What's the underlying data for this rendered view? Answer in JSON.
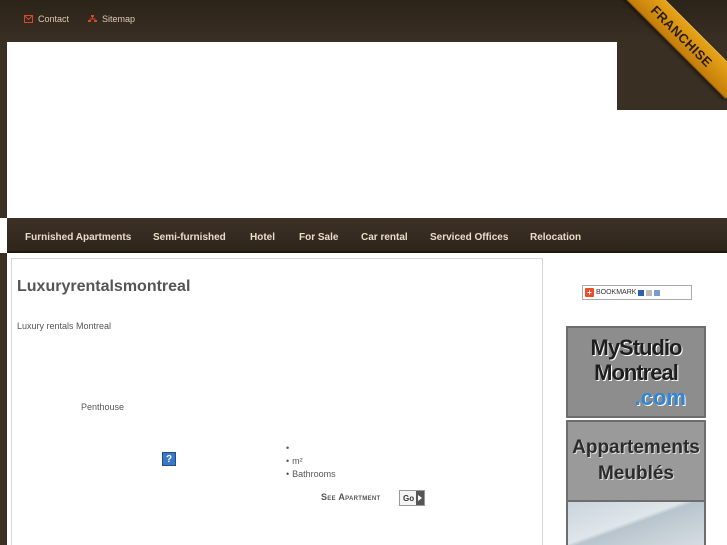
{
  "topbar": {
    "contact_label": "Contact",
    "sitemap_label": "Sitemap"
  },
  "header": {
    "ribbon_label": "FRANCHISE"
  },
  "nav": {
    "items": [
      {
        "label": "Furnished Apartments"
      },
      {
        "label": "Semi-furnished"
      },
      {
        "label": "Hotel"
      },
      {
        "label": "For Sale"
      },
      {
        "label": "Car rental"
      },
      {
        "label": "Serviced Offices"
      },
      {
        "label": "Relocation"
      }
    ]
  },
  "main": {
    "title": "Luxuryrentalsmontreal",
    "subtitle": "Luxury rentals Montreal",
    "property_type": "Penthouse",
    "info_icon_glyph": "?",
    "specs": [
      "",
      "m²",
      "Bathrooms"
    ],
    "see_apartment_label": "See Apartment",
    "go_label": "Go"
  },
  "sidebar": {
    "bookmark_label": "BOOKMARK",
    "ad1": {
      "line1": "MyStudio",
      "line2": "Montreal",
      "line3": ".com"
    },
    "ad2": {
      "line1": "Appartements",
      "line2": "Meublés"
    }
  },
  "colors": {
    "header_brown": "#3a2f23",
    "nav_text": "#e8dccb",
    "ribbon_orange": "#e8a418",
    "link_accent": "#d44a2a"
  },
  "icons": {
    "contact": "envelope-icon",
    "sitemap": "sitemap-icon",
    "info": "question-icon",
    "go": "arrow-right-icon"
  }
}
